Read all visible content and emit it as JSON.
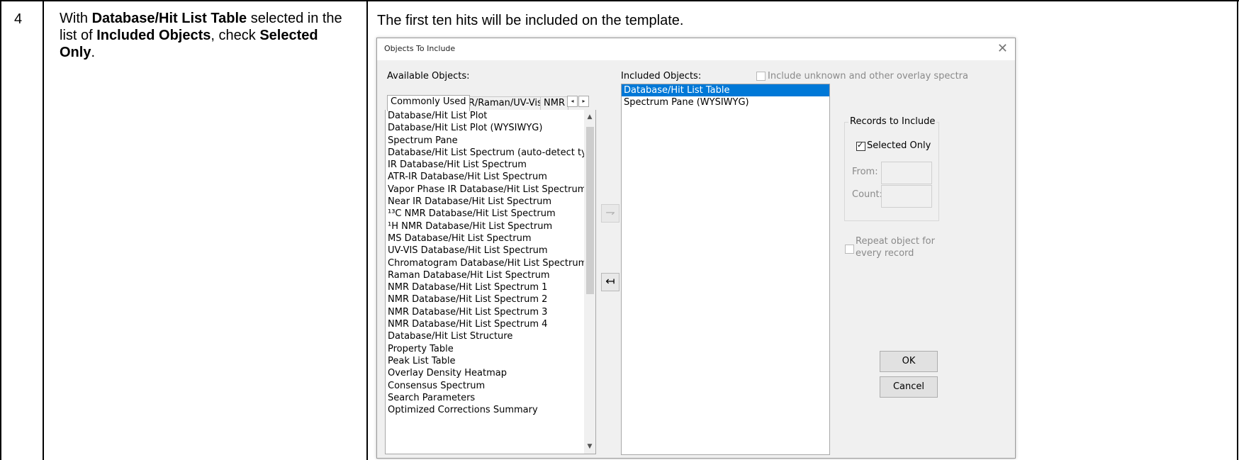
{
  "step": {
    "number": "4",
    "text_with": "With ",
    "bold_object": "Database/Hit List Table",
    "text_selected": " selected in the list of ",
    "bold_list": "Included Objects",
    "text_check": ", check ",
    "bold_option": "Selected Only",
    "text_end": "."
  },
  "note": "The first ten hits will be included on the template.",
  "dialog": {
    "title": "Objects To Include",
    "close_icon": "close-icon",
    "available_label": "Available Objects:",
    "included_label": "Included Objects:",
    "include_unknown_label": "Include unknown and other overlay spectra",
    "include_unknown_checked": false,
    "tabs": [
      "Commonly Used",
      "IR/Raman/UV-Vis",
      "NMR"
    ],
    "active_tab": "Commonly Used",
    "available_items": [
      "Database/Hit List Plot",
      "Database/Hit List Plot (WYSIWYG)",
      "Spectrum Pane",
      "Database/Hit List Spectrum (auto-detect type)",
      "IR Database/Hit List Spectrum",
      "ATR-IR Database/Hit List Spectrum",
      "Vapor Phase IR Database/Hit List Spectrum",
      "Near IR Database/Hit List Spectrum",
      "¹³C NMR Database/Hit List Spectrum",
      "¹H NMR Database/Hit List Spectrum",
      "MS Database/Hit List Spectrum",
      "UV-VIS Database/Hit List Spectrum",
      "Chromatogram Database/Hit List Spectrum",
      "Raman Database/Hit List Spectrum",
      "NMR Database/Hit List Spectrum 1",
      "NMR Database/Hit List Spectrum 2",
      "NMR Database/Hit List Spectrum 3",
      "NMR Database/Hit List Spectrum 4",
      "Database/Hit List Structure",
      "Property Table",
      "Peak List Table",
      "Overlay Density Heatmap",
      "Consensus Spectrum",
      "Search Parameters",
      "Optimized Corrections Summary"
    ],
    "included_items": [
      "Database/Hit List Table",
      "Spectrum Pane (WYSIWYG)"
    ],
    "selected_included": "Database/Hit List Table",
    "add_icon": "arrow-right-icon",
    "remove_icon": "arrow-left-icon",
    "records_group_label": "Records to Include",
    "selected_only_label": "Selected Only",
    "selected_only_checked": true,
    "from_label": "From:",
    "count_label": "Count:",
    "repeat_label_line1": "Repeat object for",
    "repeat_label_line2": "every record",
    "repeat_checked": false,
    "ok_label": "OK",
    "cancel_label": "Cancel",
    "selection_color": "#0078d7"
  }
}
